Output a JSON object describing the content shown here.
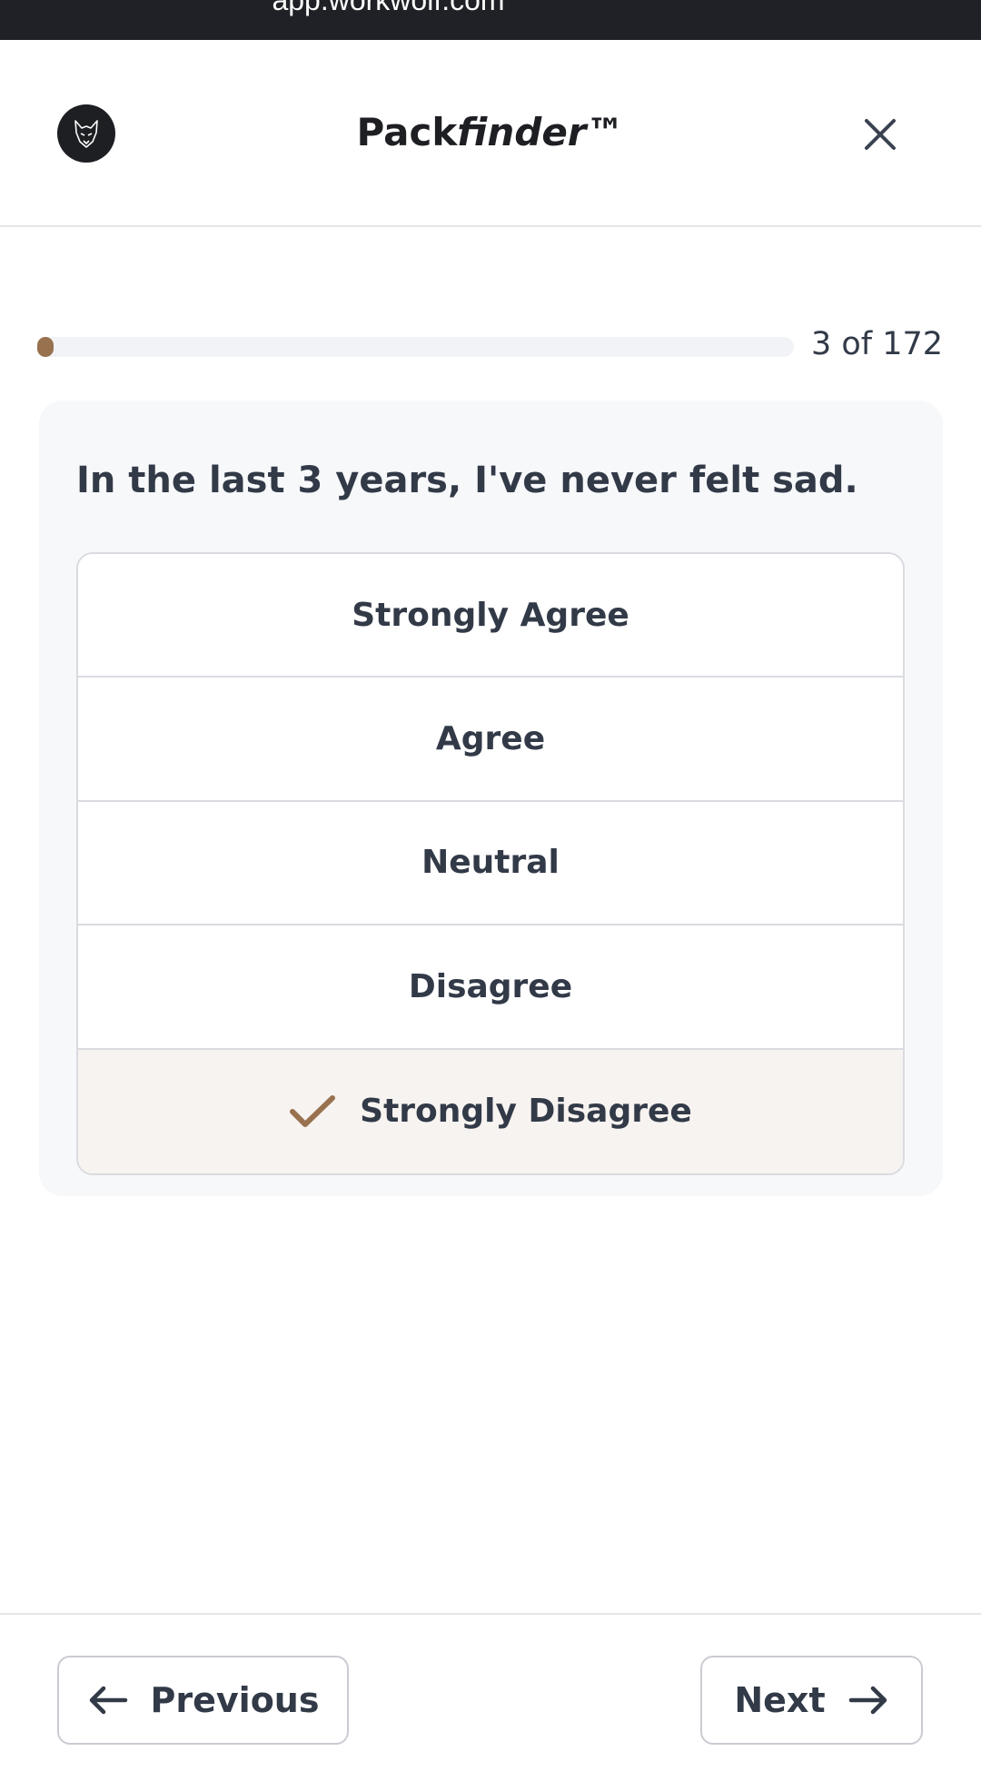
{
  "browser": {
    "url": "app.workwolf.com"
  },
  "header": {
    "title_prefix": "Pack",
    "title_italic": "finder",
    "title_suffix": "™",
    "logo_icon": "wolf-logo-icon",
    "close_icon": "close-icon"
  },
  "progress": {
    "current": 3,
    "total": 172,
    "label": "3 of 172",
    "fraction": 0.0174
  },
  "question": {
    "text": "In the last 3 years, I've never felt sad."
  },
  "options": [
    {
      "label": "Strongly Agree",
      "selected": false
    },
    {
      "label": "Agree",
      "selected": false
    },
    {
      "label": "Neutral",
      "selected": false
    },
    {
      "label": "Disagree",
      "selected": false
    },
    {
      "label": "Strongly Disagree",
      "selected": true
    }
  ],
  "footer": {
    "previous_label": "Previous",
    "next_label": "Next",
    "previous_icon": "arrow-left-icon",
    "next_icon": "arrow-right-icon"
  },
  "colors": {
    "accent": "#98714f",
    "text": "#323a48",
    "selected_bg": "#f7f3f0",
    "card_bg": "#f7f8fa",
    "url_bar": "#1f2126"
  }
}
